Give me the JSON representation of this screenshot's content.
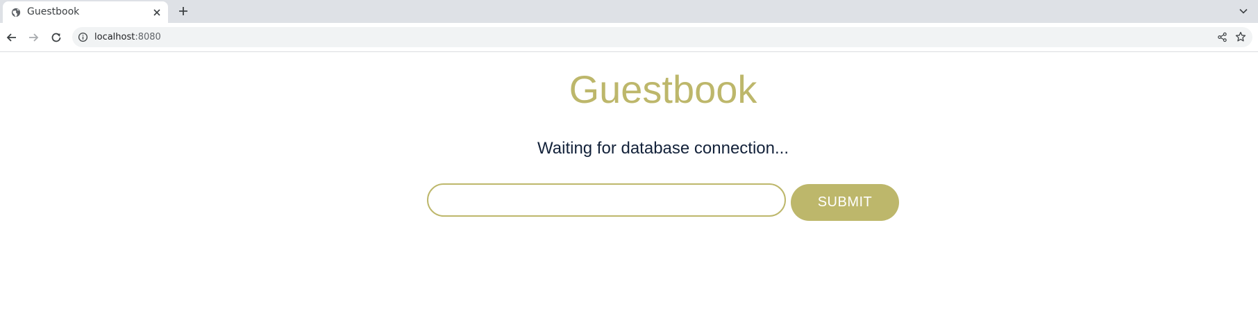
{
  "browser": {
    "tab": {
      "title": "Guestbook",
      "favicon": "globe-icon"
    },
    "address_bar": {
      "host": "localhost",
      "port": ":8080"
    },
    "icons": {
      "back": "arrow-left-icon",
      "forward": "arrow-right-icon",
      "reload": "reload-icon",
      "site_info": "info-icon",
      "share": "share-icon",
      "bookmark": "star-icon",
      "new_tab": "plus-icon",
      "tab_close": "close-icon",
      "tab_menu": "chevron-down-icon"
    }
  },
  "page": {
    "title": "Guestbook",
    "status": "Waiting for database connection...",
    "entry_input": {
      "value": "",
      "placeholder": ""
    },
    "submit_label": "SUBMIT"
  },
  "colors": {
    "accent": "#bdb76b",
    "status_text": "#13223a",
    "tabstrip": "#dee1e6",
    "omnibox": "#f1f3f4"
  }
}
